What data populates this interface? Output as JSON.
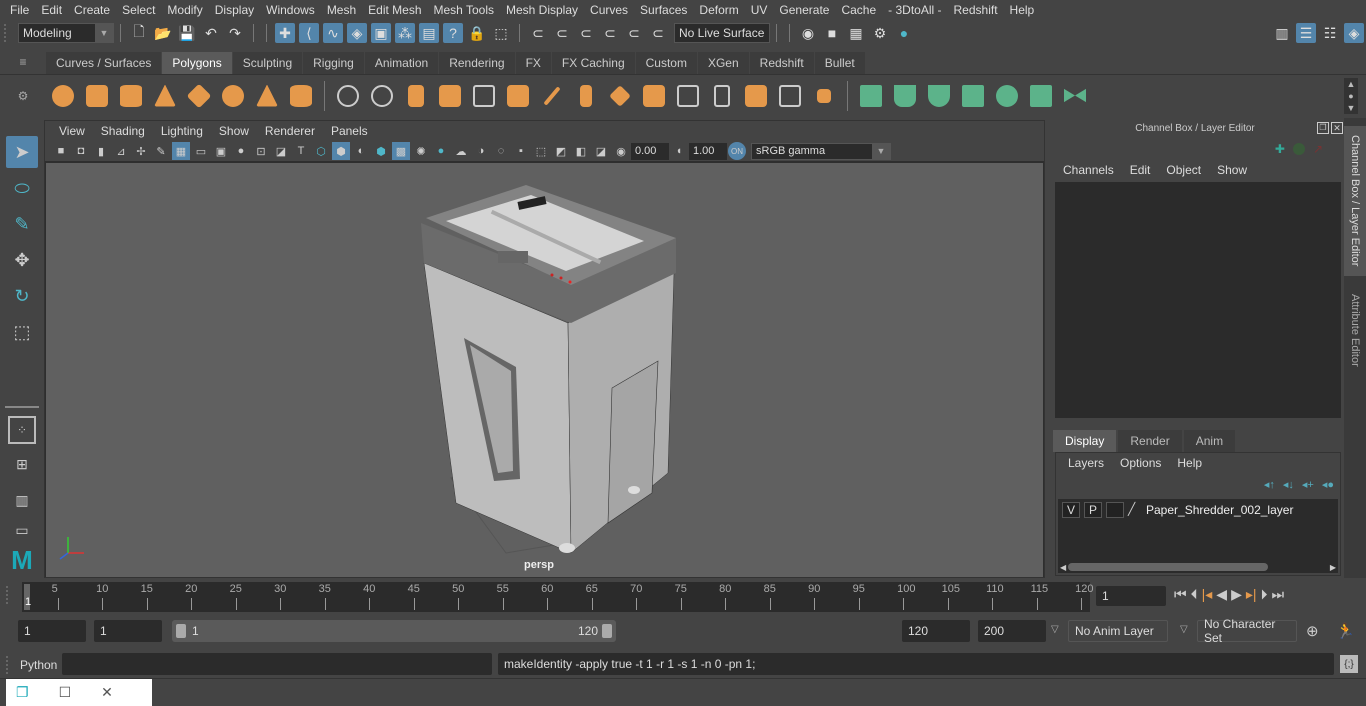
{
  "menubar": [
    "File",
    "Edit",
    "Create",
    "Select",
    "Modify",
    "Display",
    "Windows",
    "Mesh",
    "Edit Mesh",
    "Mesh Tools",
    "Mesh Display",
    "Curves",
    "Surfaces",
    "Deform",
    "UV",
    "Generate",
    "Cache",
    "- 3DtoAll -",
    "Redshift",
    "Help"
  ],
  "statusline": {
    "mode": "Modeling",
    "live_surface": "No Live Surface"
  },
  "shelf": {
    "tabs": [
      "Curves / Surfaces",
      "Polygons",
      "Sculpting",
      "Rigging",
      "Animation",
      "Rendering",
      "FX",
      "FX Caching",
      "Custom",
      "XGen",
      "Redshift",
      "Bullet"
    ],
    "active_tab": "Polygons"
  },
  "viewport": {
    "menu": [
      "View",
      "Shading",
      "Lighting",
      "Show",
      "Renderer",
      "Panels"
    ],
    "exposure": "0.00",
    "gamma": "1.00",
    "color_space": "sRGB gamma",
    "camera": "persp"
  },
  "channel_box": {
    "title": "Channel Box / Layer Editor",
    "menu": [
      "Channels",
      "Edit",
      "Object",
      "Show"
    ]
  },
  "layer_editor": {
    "tabs": [
      "Display",
      "Render",
      "Anim"
    ],
    "active_tab": "Display",
    "menu": [
      "Layers",
      "Options",
      "Help"
    ],
    "layers": [
      {
        "v": "V",
        "p": "P",
        "name": "Paper_Shredder_002_layer"
      }
    ]
  },
  "side_tabs": [
    "Channel Box / Layer Editor",
    "Attribute Editor"
  ],
  "timeline": {
    "ticks": [
      5,
      10,
      15,
      20,
      25,
      30,
      35,
      40,
      45,
      50,
      55,
      60,
      65,
      70,
      75,
      80,
      85,
      90,
      95,
      100,
      105,
      110,
      115,
      120
    ],
    "start_label": "1",
    "current_frame": "1"
  },
  "range": {
    "start": "1",
    "playback_start": "1",
    "slider_start": "1",
    "slider_end": "120",
    "playback_end": "120",
    "end": "200",
    "anim_layer": "No Anim Layer",
    "character_set": "No Character Set"
  },
  "command": {
    "language": "Python",
    "input": "",
    "result": "makeIdentity -apply true -t 1 -r 1 -s 1 -n 0 -pn 1;"
  }
}
